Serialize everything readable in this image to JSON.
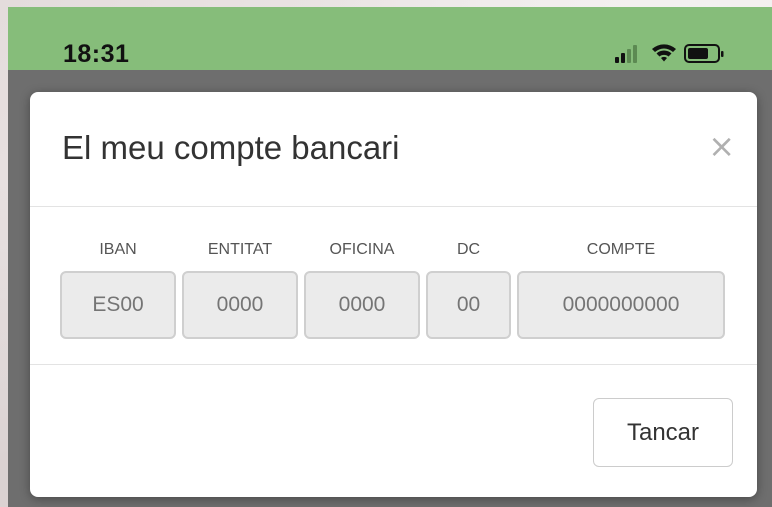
{
  "status_bar": {
    "time": "18:31",
    "icons": [
      "signal-icon",
      "wifi-icon",
      "battery-icon"
    ],
    "color": "#86bd7a"
  },
  "modal": {
    "title": "El meu compte bancari",
    "close_icon": "×",
    "fields": [
      {
        "label": "IBAN",
        "placeholder": "ES00"
      },
      {
        "label": "ENTITAT",
        "placeholder": "0000"
      },
      {
        "label": "OFICINA",
        "placeholder": "0000"
      },
      {
        "label": "DC",
        "placeholder": "00"
      },
      {
        "label": "COMPTE",
        "placeholder": "0000000000"
      }
    ],
    "close_button_label": "Tancar"
  }
}
